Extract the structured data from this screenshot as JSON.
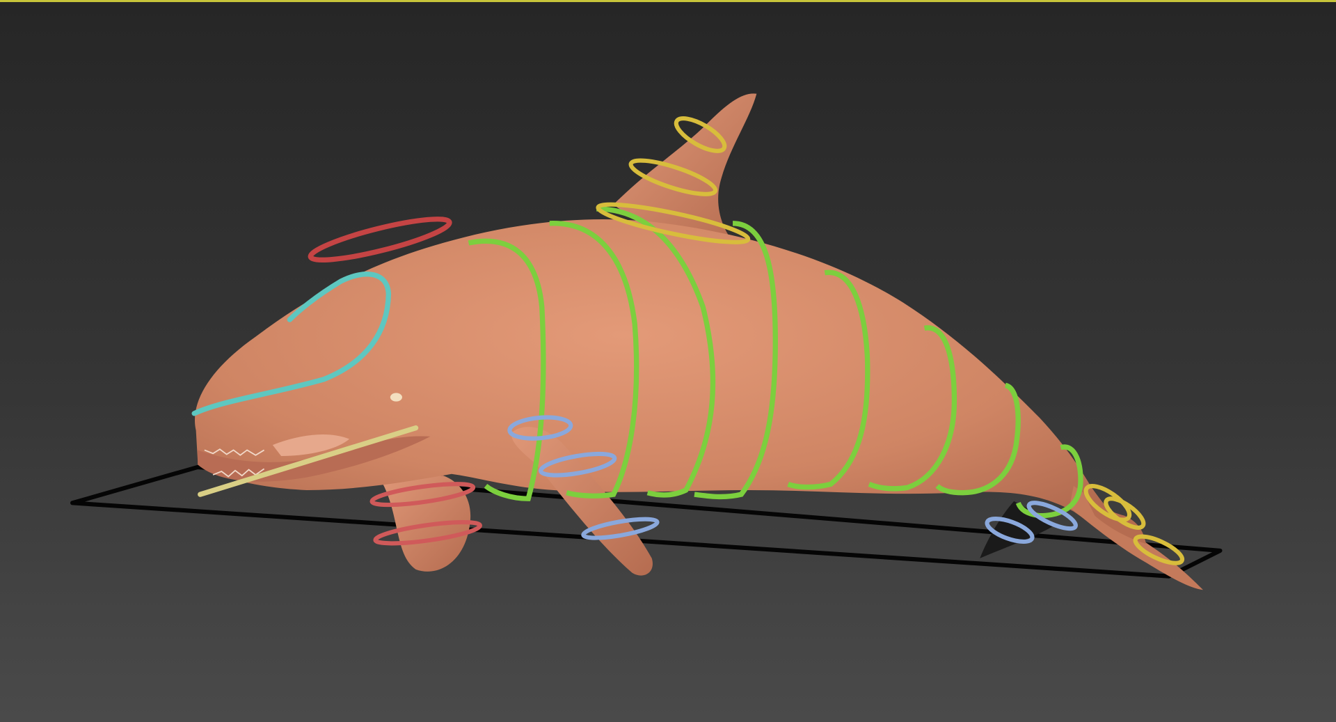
{
  "viewport": {
    "label": "",
    "active_border_color": "#c7c43a",
    "background_top": "#262626",
    "background_bottom": "#4a4a4a"
  },
  "scene": {
    "object": "orca-whale-mesh",
    "mesh_color": "#d38a6a",
    "controls": [
      {
        "name": "head-control",
        "color": "#5ec7c0"
      },
      {
        "name": "spine-controls",
        "color": "#7ccf3e"
      },
      {
        "name": "dorsal-fin-controls",
        "color": "#d8bd3c"
      },
      {
        "name": "pectoral-fin-controls",
        "color": "#8aa8dc"
      },
      {
        "name": "jaw-controls",
        "color": "#d9cf86"
      },
      {
        "name": "lower-fin-controls",
        "color": "#d05a5a"
      },
      {
        "name": "eye-target-control",
        "color": "#c54444"
      },
      {
        "name": "tail-controls",
        "color": "#d8bd3c"
      },
      {
        "name": "root-control",
        "color": "#000000"
      }
    ]
  }
}
